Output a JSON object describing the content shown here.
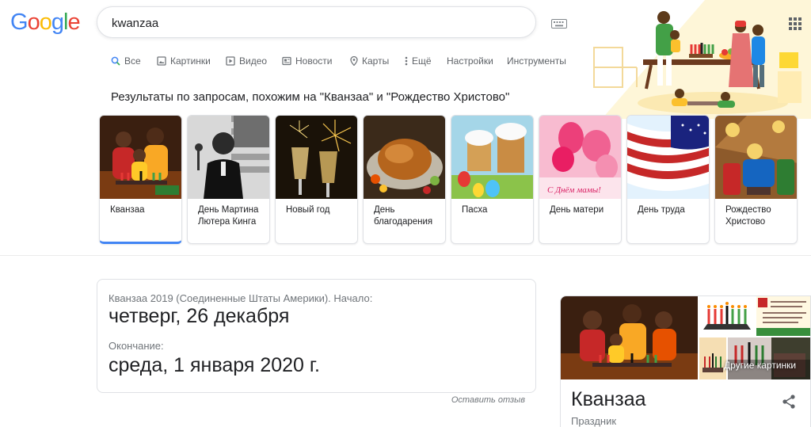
{
  "logo": {
    "letters": [
      "G",
      "o",
      "o",
      "g",
      "l",
      "e"
    ],
    "colors": [
      "#4285f4",
      "#ea4335",
      "#fbbc05",
      "#4285f4",
      "#34a853",
      "#ea4335"
    ]
  },
  "search": {
    "query": "kwanzaa"
  },
  "tabs": [
    {
      "label": "Все",
      "icon": "search-icon"
    },
    {
      "label": "Картинки",
      "icon": "image-icon"
    },
    {
      "label": "Видео",
      "icon": "video-icon"
    },
    {
      "label": "Новости",
      "icon": "news-icon"
    },
    {
      "label": "Карты",
      "icon": "map-pin-icon"
    },
    {
      "label": "Ещё",
      "icon": "more-vert-icon"
    },
    {
      "label": "Настройки"
    },
    {
      "label": "Инструменты"
    }
  ],
  "related": {
    "title": "Результаты по запросам, похожим на \"Кванзаа\" и \"Рождество Христово\"",
    "cards": [
      {
        "label": "Кванзаа"
      },
      {
        "label": "День Мартина Лютера Кинга"
      },
      {
        "label": "Новый год"
      },
      {
        "label": "День благодарения"
      },
      {
        "label": "Пасха"
      },
      {
        "label": "День матери"
      },
      {
        "label": "День труда"
      },
      {
        "label": "Рождество Христово"
      }
    ]
  },
  "dates": {
    "start_label": "Кванзаа 2019 (Соединенные Штаты Америки). Начало:",
    "start_value": "четверг, 26 декабря",
    "end_label": "Окончание:",
    "end_value": "среда, 1 января 2020 г."
  },
  "feedback": "Оставить отзыв",
  "knowledge_panel": {
    "more_images": "Другие картинки",
    "title": "Кванзаа",
    "subtitle": "Праздник"
  },
  "colors": {
    "accent": "#4285f4",
    "muted": "#70757a",
    "border": "#dfe1e5"
  }
}
